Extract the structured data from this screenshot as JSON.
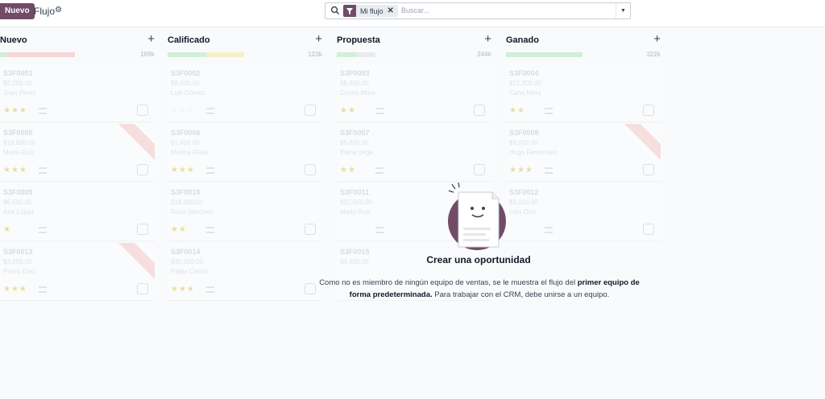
{
  "topbar": {
    "new_button": "Nuevo",
    "breadcrumb": "Flujo",
    "gear_icon": "gear-icon"
  },
  "search": {
    "facet_label": "Mi flujo",
    "facet_icon": "filter-icon",
    "placeholder": "Buscar..."
  },
  "columns": [
    {
      "title": "Nuevo",
      "amount": "109k"
    },
    {
      "title": "Calificado",
      "amount": "123k"
    },
    {
      "title": "Propuesta",
      "amount": "244k"
    },
    {
      "title": "Ganado",
      "amount": "322k"
    }
  ],
  "cards": {
    "c0_0": {
      "ref": "S3F0001",
      "amt": "$2,200.00",
      "who": "Juan Pérez",
      "stars": "★★★"
    },
    "c0_1": {
      "ref": "S3F0005",
      "amt": "$19,800.00",
      "who": "María Ruiz",
      "stars": "★★★"
    },
    "c0_2": {
      "ref": "S3F0009",
      "amt": "$6,500.00",
      "who": "Ana López",
      "stars": "★"
    },
    "c0_3": {
      "ref": "S3F0013",
      "amt": "$3,800.00",
      "who": "Pedro Díaz",
      "stars": "★★★"
    },
    "c1_0": {
      "ref": "S3F0002",
      "amt": "$9,900.00",
      "who": "Luis Gómez",
      "stars": ""
    },
    "c1_1": {
      "ref": "S3F0006",
      "amt": "$1,450.00",
      "who": "Marina Rivas",
      "stars": "★★★"
    },
    "c1_2": {
      "ref": "S3F0010",
      "amt": "$18,000.00",
      "who": "Rosa Sánchez",
      "stars": "★★"
    },
    "c1_3": {
      "ref": "S3F0014",
      "amt": "$40,000.00",
      "who": "Pablo Castro",
      "stars": "★★★"
    },
    "c2_0": {
      "ref": "S3F0003",
      "amt": "$8,400.00",
      "who": "Carlos Mora",
      "stars": "★★"
    },
    "c2_1": {
      "ref": "S3F0007",
      "amt": "$5,600.00",
      "who": "Elena Vega",
      "stars": "★★"
    },
    "c2_2": {
      "ref": "S3F0011",
      "amt": "$22,000.00",
      "who": "Mario Ruiz",
      "stars": ""
    },
    "c2_3": {
      "ref": "S3F0015",
      "amt": "$4,900.00",
      "who": "",
      "stars": "★★"
    },
    "c3_0": {
      "ref": "S3F0004",
      "amt": "$12,300.00",
      "who": "Carla Mora",
      "stars": "★★"
    },
    "c3_1": {
      "ref": "S3F0008",
      "amt": "$9,000.00",
      "who": "Hugo Fernández",
      "stars": "★★★"
    },
    "c3_2": {
      "ref": "S3F0012",
      "amt": "$5,000.00",
      "who": "Inés Ortiz",
      "stars": ""
    },
    "c3_3": {
      "ref": "",
      "amt": "",
      "who": "",
      "stars": ""
    }
  },
  "empty_state": {
    "title": "Crear una oportunidad",
    "text_1": "Como no es miembro de ningún equipo de ventas, se le muestra el flujo del ",
    "text_bold": "primer equipo de forma predeterminada.",
    "text_2": " Para trabajar con el CRM, debe unirse a un equipo."
  },
  "colors": {
    "brand": "#714b67",
    "progress_green": "#d1eed9",
    "progress_yellow": "#f7efc8",
    "progress_red": "#f6d6d6",
    "progress_gray": "#e9ecef"
  }
}
